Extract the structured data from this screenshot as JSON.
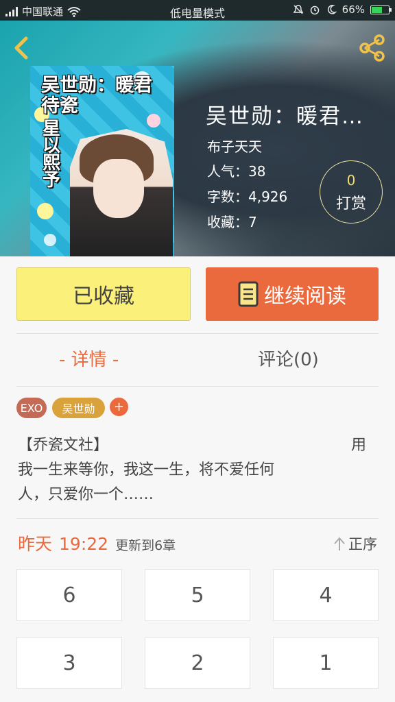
{
  "status_bar": {
    "carrier": "中国联通",
    "mode": "低电量模式",
    "battery": "66%",
    "battery_level": 0.66
  },
  "book": {
    "title": "吴世勋：暖君…",
    "author": "布子天天",
    "popularity": "人气：38",
    "word_count": "字数：4,926",
    "favorites": "收藏：7",
    "cover_title": "吴世勋：暖君待瓷",
    "cover_subtitle": "星以熙予"
  },
  "reward": {
    "count": "0",
    "label": "打赏"
  },
  "actions": {
    "favorited_label": "已收藏",
    "continue_label": "继续阅读"
  },
  "tabs": {
    "detail": "- 详情 -",
    "comment": "评论(0)"
  },
  "tags": [
    {
      "label": "EXO",
      "color": "#c56a55"
    },
    {
      "label": "吴世勋",
      "color": "#d9a23b"
    }
  ],
  "tag_add": "+",
  "description": {
    "line1": "【乔瓷文社】",
    "line1_tail": "用",
    "line2": "我一生来等你，我这一生，将不爱任何",
    "line3": "人，只爱你一个……"
  },
  "update": {
    "day": "昨天",
    "time": "19:22",
    "text": "更新到6章"
  },
  "sort": {
    "label": "正序"
  },
  "chapters": [
    "6",
    "5",
    "4",
    "3",
    "2",
    "1"
  ],
  "colors": {
    "accent": "#ea6a3e",
    "favorite": "#faf07a"
  }
}
